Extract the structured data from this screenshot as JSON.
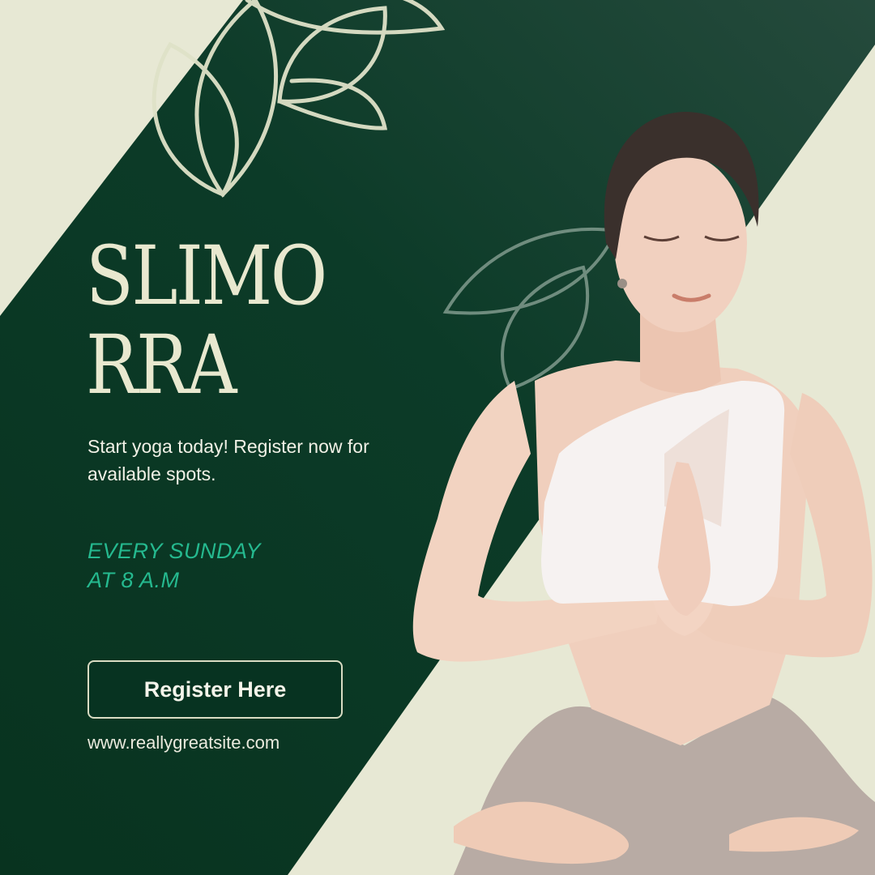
{
  "poster": {
    "title": "SLIMO\nRRA",
    "subtitle": "Start yoga today! Register now for available spots.",
    "schedule_line1": "EVERY SUNDAY",
    "schedule_line2": "AT 8 A.M",
    "cta_label": "Register Here",
    "website": "www.reallygreatsite.com"
  },
  "icons": [
    "lotus-petals-icon",
    "lotus-outline-icon"
  ],
  "colors": {
    "background": "#e7e8d4",
    "band": "#0b3a26",
    "title": "#e8e8cf",
    "accent": "#25b98f",
    "button": "#073321"
  },
  "photo": {
    "subject": "yoga-meditation-figure"
  }
}
